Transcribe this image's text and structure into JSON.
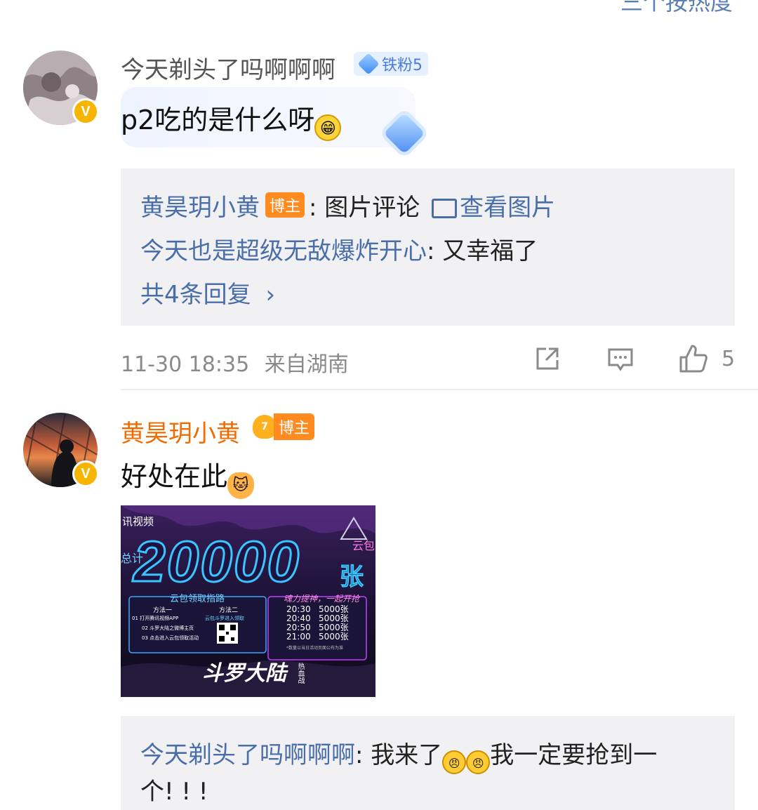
{
  "top_cut_text": "三个按热度",
  "comments": [
    {
      "username": "今天剃头了吗啊啊啊",
      "fan_badge": "铁粉5",
      "verified_mark": "V",
      "content": "p2吃的是什么呀",
      "replies": {
        "line1_user": "黄昊玥小黄",
        "line1_tag": "博主",
        "line1_sep": ":",
        "line1_text": "图片评论",
        "line1_link": "查看图片",
        "line2_user": "今天也是超级无敌爆炸开心",
        "line2_text": ": 又幸福了",
        "more": "共4条回复",
        "more_chevron": "›"
      },
      "timestamp": "11-30 18:35",
      "location": "来自湖南",
      "like_count": "5"
    },
    {
      "username": "黄昊玥小黄",
      "badge_level": "7",
      "badge_label": "博主",
      "verified_mark": "V",
      "content": "好处在此",
      "image": {
        "brand": "讯视频",
        "headline_prefix": "总计",
        "headline": "20000",
        "headline_suffix": "张",
        "corner": "云包",
        "guide_title": "云包领取指路",
        "method1": "方法一",
        "method2": "方法二",
        "step1": "01 打开腾讯视频APP",
        "step2": "02 斗罗大陆之微博主页",
        "step3": "03 点击进入云包领取活动",
        "step_right": "云包斗罗进入领取",
        "slogan": "魂力提神，一起开抢",
        "schedule": [
          {
            "time": "20:30",
            "amount": "5000张"
          },
          {
            "time": "20:40",
            "amount": "5000张"
          },
          {
            "time": "20:50",
            "amount": "5000张"
          },
          {
            "time": "21:00",
            "amount": "5000张"
          }
        ],
        "footnote": "*数量以当日活动页面公布为准",
        "logo": "斗罗大陆",
        "logo_sub": "热血战"
      },
      "reply": {
        "user": "今天剃头了吗啊啊啊",
        "text_line1": ": 我来了",
        "text_line1_after": "我一定要抢到一",
        "text_line2": "个! ! !"
      }
    }
  ]
}
